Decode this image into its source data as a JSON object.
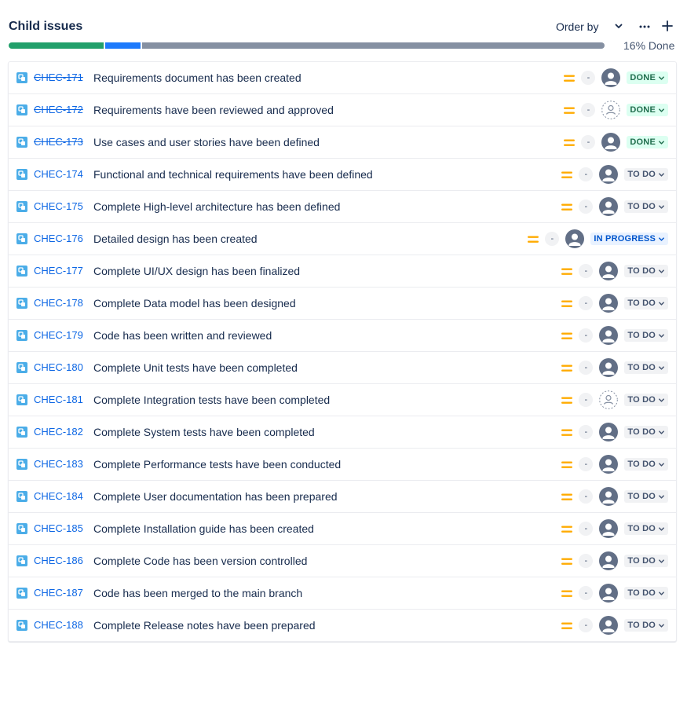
{
  "header": {
    "title": "Child issues",
    "order_label": "Order by",
    "progress_label": "16% Done"
  },
  "progress": {
    "done_fraction": 0.16,
    "in_progress_fraction": 0.06,
    "todo_fraction": 0.78
  },
  "colors": {
    "done": "#22a06b",
    "in_progress": "#1d7afc",
    "todo": "#8590a2",
    "priority": "#ffab00",
    "link": "#0c66e4"
  },
  "issues": [
    {
      "key": "CHEC-171",
      "summary": "Requirements document has been created",
      "estimate": "-",
      "status": "DONE",
      "status_type": "done",
      "assigned": true
    },
    {
      "key": "CHEC-172",
      "summary": "Requirements have been reviewed and approved",
      "estimate": "-",
      "status": "DONE",
      "status_type": "done",
      "assigned": false
    },
    {
      "key": "CHEC-173",
      "summary": "Use cases and user stories have been defined",
      "estimate": "-",
      "status": "DONE",
      "status_type": "done",
      "assigned": true
    },
    {
      "key": "CHEC-174",
      "summary": "Functional and technical requirements have been defined",
      "estimate": "-",
      "status": "TO DO",
      "status_type": "todo",
      "assigned": true
    },
    {
      "key": "CHEC-175",
      "summary": "Complete High-level architecture has been defined",
      "estimate": "-",
      "status": "TO DO",
      "status_type": "todo",
      "assigned": true
    },
    {
      "key": "CHEC-176",
      "summary": "Detailed design has been created",
      "estimate": "-",
      "status": "IN PROGRESS",
      "status_type": "inprogress",
      "assigned": true
    },
    {
      "key": "CHEC-177",
      "summary": "Complete UI/UX design has been finalized",
      "estimate": "-",
      "status": "TO DO",
      "status_type": "todo",
      "assigned": true
    },
    {
      "key": "CHEC-178",
      "summary": "Complete Data model has been designed",
      "estimate": "-",
      "status": "TO DO",
      "status_type": "todo",
      "assigned": true
    },
    {
      "key": "CHEC-179",
      "summary": "Code has been written and reviewed",
      "estimate": "-",
      "status": "TO DO",
      "status_type": "todo",
      "assigned": true
    },
    {
      "key": "CHEC-180",
      "summary": "Complete Unit tests have been completed",
      "estimate": "-",
      "status": "TO DO",
      "status_type": "todo",
      "assigned": true
    },
    {
      "key": "CHEC-181",
      "summary": "Complete Integration tests have been completed",
      "estimate": "-",
      "status": "TO DO",
      "status_type": "todo",
      "assigned": false
    },
    {
      "key": "CHEC-182",
      "summary": "Complete System tests have been completed",
      "estimate": "-",
      "status": "TO DO",
      "status_type": "todo",
      "assigned": true
    },
    {
      "key": "CHEC-183",
      "summary": "Complete Performance tests have been conducted",
      "estimate": "-",
      "status": "TO DO",
      "status_type": "todo",
      "assigned": true
    },
    {
      "key": "CHEC-184",
      "summary": "Complete User documentation has been prepared",
      "estimate": "-",
      "status": "TO DO",
      "status_type": "todo",
      "assigned": true
    },
    {
      "key": "CHEC-185",
      "summary": "Complete Installation guide has been created",
      "estimate": "-",
      "status": "TO DO",
      "status_type": "todo",
      "assigned": true
    },
    {
      "key": "CHEC-186",
      "summary": "Complete Code has been version controlled",
      "estimate": "-",
      "status": "TO DO",
      "status_type": "todo",
      "assigned": true
    },
    {
      "key": "CHEC-187",
      "summary": "Code has been merged to the main branch",
      "estimate": "-",
      "status": "TO DO",
      "status_type": "todo",
      "assigned": true
    },
    {
      "key": "CHEC-188",
      "summary": "Complete Release notes have been prepared",
      "estimate": "-",
      "status": "TO DO",
      "status_type": "todo",
      "assigned": true
    }
  ]
}
